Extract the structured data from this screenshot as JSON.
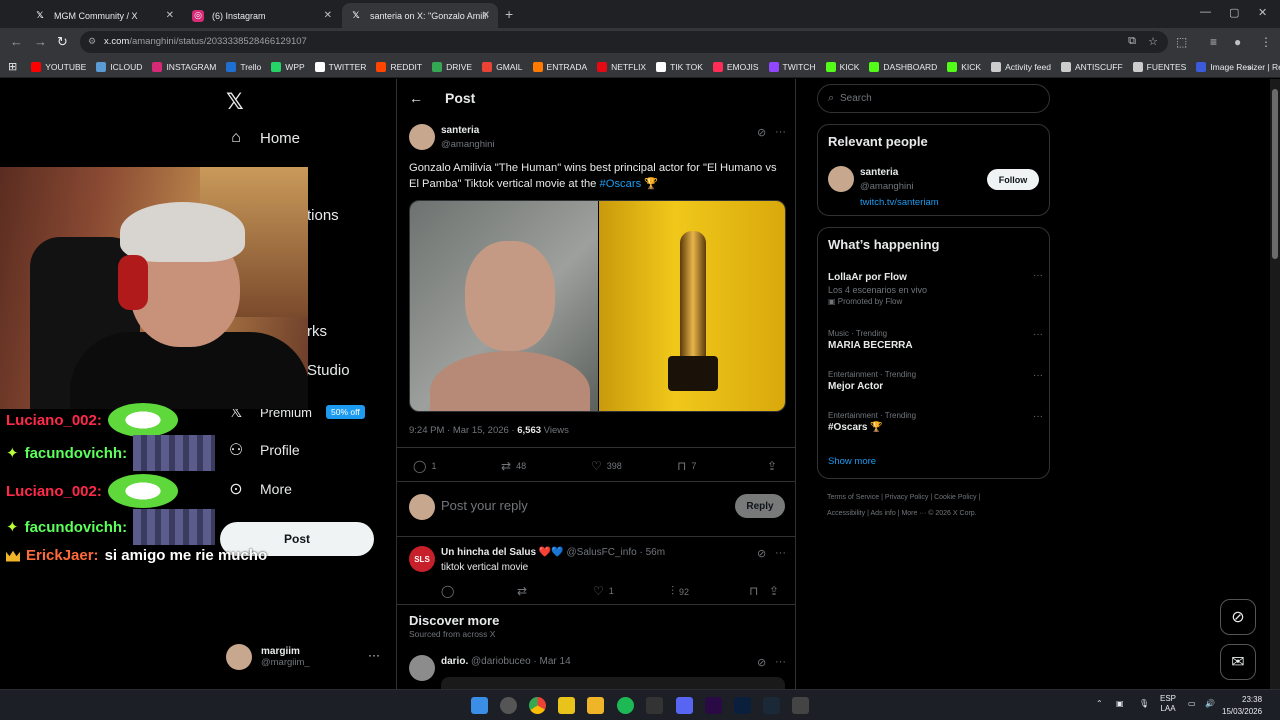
{
  "browser": {
    "tabs": [
      {
        "title": "MGM Community / X",
        "active": false
      },
      {
        "title": "(6) Instagram",
        "active": false
      },
      {
        "title": "santeria on X: \"Gonzalo Amilivia",
        "active": true
      }
    ],
    "url_host": "x.com",
    "url_path": "/amanghini/status/2033338528466129107",
    "bookmarks": [
      "YOUTUBE",
      "ICLOUD",
      "INSTAGRAM",
      "Trello",
      "WPP",
      "TWITTER",
      "REDDIT",
      "DRIVE",
      "GMAIL",
      "ENTRADA",
      "NETFLIX",
      "TIK TOK",
      "EMOJIS",
      "TWITCH",
      "KICK",
      "DASHBOARD",
      "KICK",
      "Activity feed",
      "ANTISCUFF",
      "FUENTES",
      "Image Resizer | Resi..."
    ],
    "bookmark_colors": [
      "#ff0000",
      "#5b9bd5",
      "#d62976",
      "#1f6fd1",
      "#25d366",
      "#ffffff",
      "#ff4500",
      "#34a853",
      "#ea4335",
      "#ff7a00",
      "#e50914",
      "#ffffff",
      "#ff2d55",
      "#9146ff",
      "#53fc18",
      "#53fc18",
      "#53fc18",
      "#cccccc",
      "#cccccc",
      "#cccccc",
      "#3b5bdb"
    ]
  },
  "nav": {
    "home": "Home",
    "notifications_partial": "tions",
    "bookmarks_partial": "rks",
    "studio_partial": "Studio",
    "premium": "Premium",
    "premium_badge": "50% off",
    "profile": "Profile",
    "more": "More",
    "post": "Post",
    "account_name": "margiim",
    "account_handle": "@margiim_"
  },
  "chat": [
    {
      "user": "Luciano_002:",
      "color": "red",
      "emote": "mouth"
    },
    {
      "user": "facundovichh:",
      "color": "green",
      "emote": "crowd"
    },
    {
      "user": "Luciano_002:",
      "color": "red",
      "emote": "mouth"
    },
    {
      "user": "facundovichh:",
      "color": "green",
      "emote": "crowd"
    },
    {
      "user": "ErickJaer:",
      "color": "gold",
      "message": "si amigo me rie mucho"
    }
  ],
  "post": {
    "header": "Post",
    "author_name": "santeria",
    "author_handle": "@amanghini",
    "text_main": "Gonzalo Amilivia \"The Human\" wins best principal actor for \"El Humano vs El Pamba\" Tiktok vertical movie at the ",
    "hashtag": "#Oscars",
    "trophy": "🏆",
    "timestamp": "9:24 PM · Mar 15, 2026 · ",
    "views_count": "6,563",
    "views_label": " Views",
    "replies": "1",
    "reposts": "48",
    "likes": "398",
    "bookmarks": "7",
    "reply_placeholder": "Post your reply",
    "reply_button": "Reply"
  },
  "reply": {
    "author": "Un hincha del Salus",
    "hearts": "❤️💙",
    "handle_time": "@SalusFC_info · 56m",
    "avatar_text": "SLS",
    "text": "tiktok vertical movie",
    "likes": "1",
    "views": "92"
  },
  "discover": {
    "title": "Discover more",
    "subtitle": "Sourced from across X",
    "first_author": "dario.",
    "first_handle_time": "@dariobuceo · Mar 14"
  },
  "sidebar": {
    "search_placeholder": "Search",
    "relevant_title": "Relevant people",
    "person_name": "santeria",
    "person_handle": "@amanghini",
    "person_link": "twitch.tv/santeriam",
    "follow": "Follow",
    "happening_title": "What’s happening",
    "trends": [
      {
        "context": "",
        "title": "LollaAr por Flow",
        "sub": "Los 4 escenarios en vivo",
        "promo": "Promoted by Flow"
      },
      {
        "context": "Music · Trending",
        "title": "MARIA BECERRA"
      },
      {
        "context": "Entertainment · Trending",
        "title": "Mejor Actor"
      },
      {
        "context": "Entertainment · Trending",
        "title": "#Oscars 🏆"
      }
    ],
    "show_more": "Show more",
    "footer_line1": "Terms of Service  |  Privacy Policy  |  Cookie Policy  |",
    "footer_line2": "Accessibility  |  Ads info  |  More ···  © 2026 X Corp."
  },
  "taskbar": {
    "lang": "ESP",
    "lang2": "LAA",
    "time": "23:38",
    "date": "15/03/2026"
  }
}
